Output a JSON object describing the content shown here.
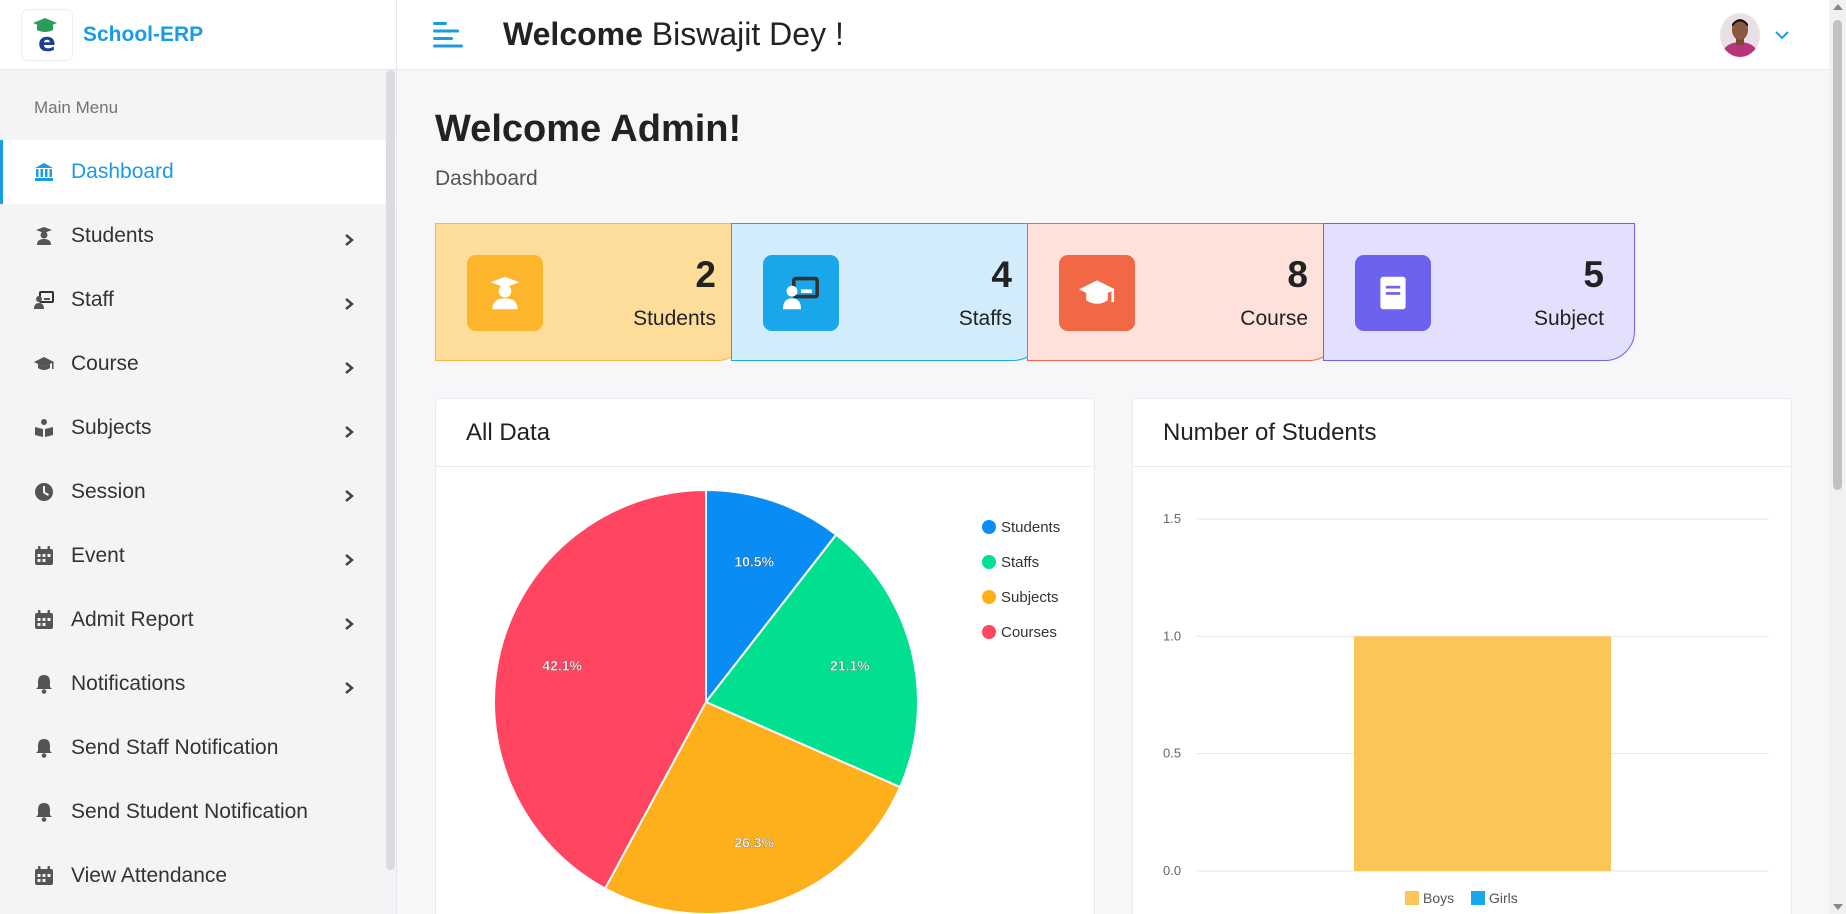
{
  "brand": {
    "name": "School-ERP"
  },
  "sidebar": {
    "menu_title": "Main Menu",
    "items": [
      {
        "label": "Dashboard",
        "icon": "bank-icon",
        "active": true,
        "has_children": false
      },
      {
        "label": "Students",
        "icon": "student-icon",
        "has_children": true
      },
      {
        "label": "Staff",
        "icon": "teacher-icon",
        "has_children": true
      },
      {
        "label": "Course",
        "icon": "graduation-cap-icon",
        "has_children": true
      },
      {
        "label": "Subjects",
        "icon": "book-reader-icon",
        "has_children": true
      },
      {
        "label": "Session",
        "icon": "clock-icon",
        "has_children": true
      },
      {
        "label": "Event",
        "icon": "calendar-icon",
        "has_children": true
      },
      {
        "label": "Admit Report",
        "icon": "calendar-icon",
        "has_children": true
      },
      {
        "label": "Notifications",
        "icon": "bell-icon",
        "has_children": true
      },
      {
        "label": "Send Staff Notification",
        "icon": "bell-icon",
        "has_children": false
      },
      {
        "label": "Send Student Notification",
        "icon": "bell-icon",
        "has_children": false
      },
      {
        "label": "View Attendance",
        "icon": "calendar-icon",
        "has_children": false
      }
    ]
  },
  "header": {
    "welcome_bold": "Welcome",
    "welcome_name": " Biswajit Dey !"
  },
  "main": {
    "title": "Welcome Admin!",
    "breadcrumb": "Dashboard",
    "stats": [
      {
        "value": "2",
        "label": "Students",
        "icon": "student-icon",
        "bg": "#fedd9b",
        "border": "#fbb836",
        "icon_bg": "#fdb52c"
      },
      {
        "value": "4",
        "label": "Staffs",
        "icon": "teacher-icon",
        "bg": "#d2ecfb",
        "border": "#1aa6ea",
        "icon_bg": "#1aa6ea"
      },
      {
        "value": "8",
        "label": "Course",
        "icon": "graduation-cap-icon",
        "bg": "#fde1da",
        "border": "#f26844",
        "icon_bg": "#f26844"
      },
      {
        "value": "5",
        "label": "Subject",
        "icon": "book-icon",
        "bg": "#e2e0fc",
        "border": "#6d62f0",
        "icon_bg": "#6d62f0"
      }
    ],
    "pie_card_title": "All Data",
    "bar_card_title": "Number of Students"
  },
  "chart_data": [
    {
      "type": "pie",
      "title": "All Data",
      "categories": [
        "Students",
        "Staffs",
        "Subjects",
        "Courses"
      ],
      "values": [
        2,
        4,
        5,
        8
      ],
      "labels": [
        "10.5%",
        "21.1%",
        "26.3%",
        "42.1%"
      ],
      "colors": [
        "#0a8cf5",
        "#00e08f",
        "#feb01c",
        "#ff4560"
      ],
      "legend": "right"
    },
    {
      "type": "bar",
      "title": "Number of Students",
      "categories": [
        ""
      ],
      "series": [
        {
          "name": "Boys",
          "values": [
            1
          ],
          "color": "#fbc557"
        },
        {
          "name": "Girls",
          "values": [
            0
          ],
          "color": "#1aa6ea"
        }
      ],
      "yticks": [
        "0.0",
        "0.5",
        "1.0",
        "1.5"
      ],
      "ylim": [
        0,
        1.5
      ],
      "grid": true,
      "legend": "bottom"
    }
  ]
}
